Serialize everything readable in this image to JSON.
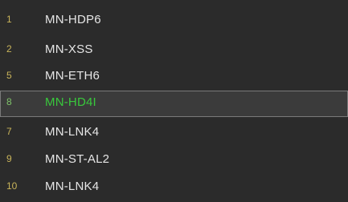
{
  "list": {
    "items": [
      {
        "number": "1",
        "name": "MN-HDP6",
        "selected": false
      },
      {
        "number": "2",
        "name": "MN-XSS",
        "selected": false
      },
      {
        "number": "5",
        "name": "MN-ETH6",
        "selected": false
      },
      {
        "number": "8",
        "name": "MN-HD4I",
        "selected": true
      },
      {
        "number": "7",
        "name": "MN-LNK4",
        "selected": false
      },
      {
        "number": "9",
        "name": "MN-ST-AL2",
        "selected": false
      },
      {
        "number": "10",
        "name": "MN-LNK4",
        "selected": false
      }
    ]
  },
  "colors": {
    "background": "#2b2b2b",
    "number_text": "#c9b45a",
    "name_text": "#e6e6e6",
    "selected_name_text": "#39c93c",
    "selected_border": "#7a7a7a"
  }
}
